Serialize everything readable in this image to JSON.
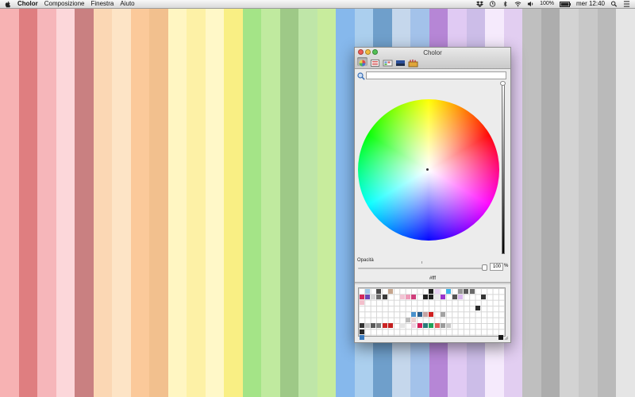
{
  "menubar": {
    "app_name": "Cholor",
    "menus": [
      "Composizione",
      "Finestra",
      "Aiuto"
    ],
    "battery": "100%",
    "clock": "mer 12:40"
  },
  "window": {
    "title": "Cholor",
    "search": {
      "value": "",
      "placeholder": ""
    },
    "opacity_label": "Opacità",
    "opacity_value": "100",
    "opacity_unit": "%",
    "hex": "#fff",
    "brightness_level": 1.0,
    "opacity_level": 1.0
  },
  "colors": {
    "stripes": [
      "#f7b2b3",
      "#df7e80",
      "#f6b6ba",
      "#fcd7da",
      "#c98081",
      "#fbd7b4",
      "#fde4c6",
      "#fbc99a",
      "#f2c08e",
      "#fff6c2",
      "#fdf1a6",
      "#fff8c8",
      "#f9ef84",
      "#a4e487",
      "#c0ea9f",
      "#9ec987",
      "#bfe6a8",
      "#c8ec9d",
      "#86b8ec",
      "#abcfee",
      "#6f9fcb",
      "#c5d7ec",
      "#a3c2ea",
      "#b686d6",
      "#e0caf3",
      "#ccbde8",
      "#f5eafc",
      "#e2cef1",
      "#bfbfbf",
      "#adadad",
      "#d3d3d3",
      "#c8c8c8",
      "#bababa",
      "#e5e5e5"
    ],
    "palette": [
      {
        "c": "#9fc9ea",
        "r": 0,
        "k": 1
      },
      {
        "c": "#4a4a4a",
        "r": 0,
        "k": 3
      },
      {
        "c": "#c6a58c",
        "r": 0,
        "k": 5
      },
      {
        "c": "#1d1d1d",
        "r": 0,
        "k": 12
      },
      {
        "c": "#e8d3f2",
        "r": 0,
        "k": 13
      },
      {
        "c": "#3bb2e6",
        "r": 0,
        "k": 15
      },
      {
        "c": "#979797",
        "r": 0,
        "k": 17
      },
      {
        "c": "#5c5c5c",
        "r": 0,
        "k": 18
      },
      {
        "c": "#6a6a6a",
        "r": 0,
        "k": 19
      },
      {
        "c": "#d4295a",
        "r": 1,
        "k": 0
      },
      {
        "c": "#6a48b6",
        "r": 1,
        "k": 1
      },
      {
        "c": "#d6d6d6",
        "r": 1,
        "k": 2
      },
      {
        "c": "#6d6d6d",
        "r": 1,
        "k": 3
      },
      {
        "c": "#3a3a3a",
        "r": 1,
        "k": 4
      },
      {
        "c": "#f2c4d4",
        "r": 1,
        "k": 7
      },
      {
        "c": "#ee9ab8",
        "r": 1,
        "k": 8
      },
      {
        "c": "#cf3d7a",
        "r": 1,
        "k": 9
      },
      {
        "c": "#1f1f1f",
        "r": 1,
        "k": 11
      },
      {
        "c": "#222222",
        "r": 1,
        "k": 12
      },
      {
        "c": "#e9e9e9",
        "r": 1,
        "k": 13
      },
      {
        "c": "#9933cc",
        "r": 1,
        "k": 14
      },
      {
        "c": "#555555",
        "r": 1,
        "k": 16
      },
      {
        "c": "#d9b8ee",
        "r": 1,
        "k": 17
      },
      {
        "c": "#333333",
        "r": 1,
        "k": 21
      },
      {
        "c": "#f3c0cc",
        "r": 2,
        "k": 0
      },
      {
        "c": "#2c2c2c",
        "r": 3,
        "k": 20
      },
      {
        "c": "#4a91cc",
        "r": 4,
        "k": 9
      },
      {
        "c": "#2c5f8d",
        "r": 4,
        "k": 10
      },
      {
        "c": "#c4a3a3",
        "r": 4,
        "k": 11
      },
      {
        "c": "#d02121",
        "r": 4,
        "k": 12
      },
      {
        "c": "#a3a3a3",
        "r": 4,
        "k": 14
      },
      {
        "c": "#bbbbbb",
        "r": 5,
        "k": 8
      },
      {
        "c": "#ebd0d0",
        "r": 5,
        "k": 9
      },
      {
        "c": "#333333",
        "r": 6,
        "k": 0
      },
      {
        "c": "#c2c2c2",
        "r": 6,
        "k": 1
      },
      {
        "c": "#5a5a5a",
        "r": 6,
        "k": 2
      },
      {
        "c": "#7d7d7d",
        "r": 6,
        "k": 3
      },
      {
        "c": "#cc2424",
        "r": 6,
        "k": 4
      },
      {
        "c": "#c21e1e",
        "r": 6,
        "k": 5
      },
      {
        "c": "#e5e5e5",
        "r": 6,
        "k": 7
      },
      {
        "c": "#f0d0e0",
        "r": 6,
        "k": 9
      },
      {
        "c": "#d41e5a",
        "r": 6,
        "k": 10
      },
      {
        "c": "#2a7a7a",
        "r": 6,
        "k": 11
      },
      {
        "c": "#21a35a",
        "r": 6,
        "k": 12
      },
      {
        "c": "#e05c5c",
        "r": 6,
        "k": 13
      },
      {
        "c": "#9b9b9b",
        "r": 6,
        "k": 14
      },
      {
        "c": "#c7c7c7",
        "r": 6,
        "k": 15
      },
      {
        "c": "#2a2a2a",
        "r": 7,
        "k": 0
      },
      {
        "c": "#3b7bbf",
        "r": 8,
        "k": 0
      },
      {
        "c": "#1a1a1a",
        "r": 8,
        "k": 24
      }
    ]
  }
}
